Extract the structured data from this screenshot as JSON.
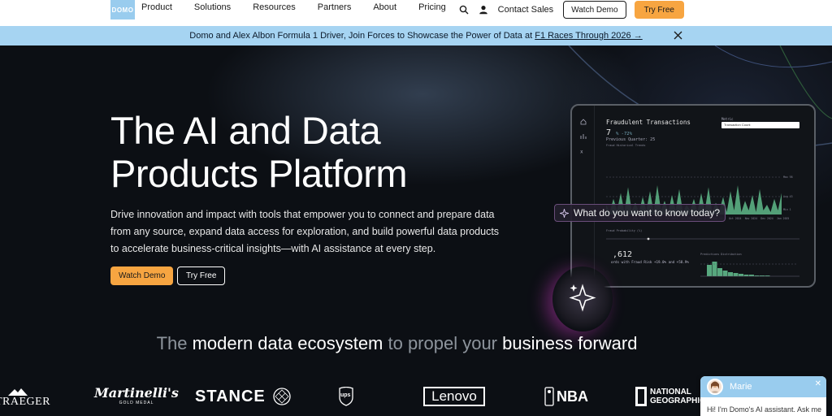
{
  "nav": {
    "logo_text": "DOMO",
    "links": [
      "Product",
      "Solutions",
      "Resources",
      "Partners",
      "About",
      "Pricing"
    ],
    "contact_label": "Contact Sales",
    "watch_demo_label": "Watch Demo",
    "try_free_label": "Try Free"
  },
  "banner": {
    "text": "Domo and Alex Albon Formula 1 Driver, Join Forces to Showcase the Power of Data at ",
    "link_text": "F1 Races Through 2026 →"
  },
  "hero": {
    "title": "The AI and Data Products Platform",
    "subtitle": "Drive innovation and impact with tools that empower you to connect and prepare data from any source, expand data access for exploration, and build powerful data products to accelerate business-critical insights—with AI assistance at every step.",
    "watch_demo_label": "Watch Demo",
    "try_free_label": "Try Free",
    "query_text": "What do you want to know today?"
  },
  "dashboard": {
    "title": "Fraudulent Transactions",
    "count": "7",
    "count_delta": "% -72%",
    "previous": "Previous Quarter: 25",
    "small_label": "Fraud Historical Trends",
    "metric_label": "Metric",
    "metric_value": "Transaction Count",
    "prob_label": "Fraud Probability (%)",
    "prob_value": ",612",
    "prob_caption": "ords with Fraud Risk +19.0% and +58.9%",
    "dist_label": "Predictions Distribution",
    "x_ticks": [
      "Feb 2024",
      "Mar 2024",
      "Apr 2024",
      "May 2024",
      "Jun 2024",
      "Jul 2024",
      "Aug 2024",
      "Sep 2024",
      "Oct 2024",
      "Nov 2024",
      "Dec 2024",
      "Jan 2025"
    ],
    "right_ticks": [
      "Max 98",
      "Avg 43",
      "Min 1"
    ]
  },
  "section": {
    "tagline_parts": [
      {
        "text": "The ",
        "highlight": false
      },
      {
        "text": "modern data ecosystem",
        "highlight": true
      },
      {
        "text": " to propel your ",
        "highlight": false
      },
      {
        "text": "business forward",
        "highlight": true
      }
    ]
  },
  "brands": [
    "TRAEGER",
    "Martinelli's",
    "GOLD MEDAL",
    "STANCE",
    "ups",
    "Lenovo",
    "NBA",
    "NATIONAL GEOGRAPHIC"
  ],
  "chat": {
    "agent_name": "Marie",
    "message": "Hi! I'm Domo's AI assistant. Ask me"
  },
  "colors": {
    "brand_blue": "#99ccee",
    "accent_orange": "#f7a541",
    "chart_green": "#5fb88a",
    "background": "#0c0f14"
  }
}
